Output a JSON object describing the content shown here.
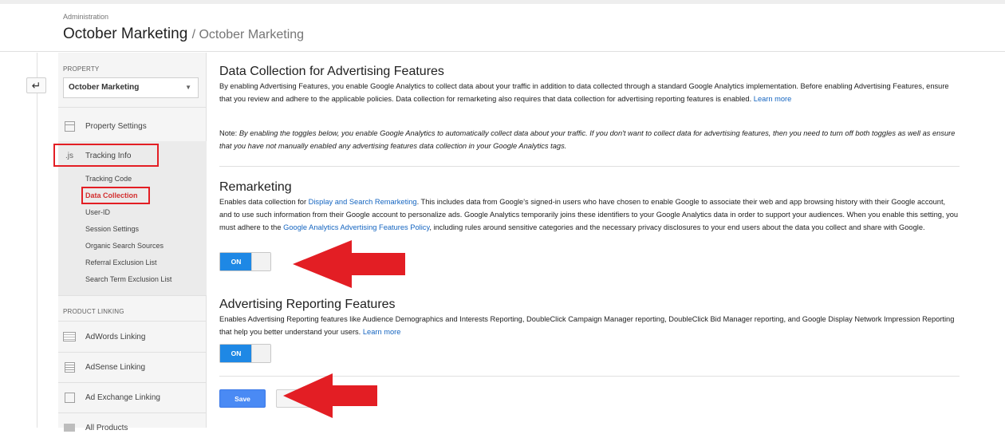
{
  "header": {
    "breadcrumb_small": "Administration",
    "title": "October Marketing",
    "subtitle": "/ October Marketing"
  },
  "sidebar": {
    "property_label": "PROPERTY",
    "property_select": "October Marketing",
    "property_settings": "Property Settings",
    "tracking_info_icon": ".js",
    "tracking_info": "Tracking Info",
    "sub_items": [
      "Tracking Code",
      "Data Collection",
      "User-ID",
      "Session Settings",
      "Organic Search Sources",
      "Referral Exclusion List",
      "Search Term Exclusion List"
    ],
    "product_linking_label": "PRODUCT LINKING",
    "adwords": "AdWords Linking",
    "adsense": "AdSense Linking",
    "adexchange": "Ad Exchange Linking",
    "all_products": "All Products"
  },
  "main": {
    "title": "Data Collection for Advertising Features",
    "intro": "By enabling Advertising Features, you enable Google Analytics to collect data about your traffic in addition to data collected through a standard Google Analytics implementation. Before enabling Advertising Features, ensure that you review and adhere to the applicable policies. Data collection for remarketing also requires that data collection for advertising reporting features is enabled.",
    "intro_link": "Learn more",
    "note_label": "Note:",
    "note_text": "By enabling the toggles below, you enable Google Analytics to automatically collect data about your traffic. If you don't want to collect data for advertising features, then you need to turn off both toggles as well as ensure that you have not manually enabled any advertising features data collection in your Google Analytics tags.",
    "remarketing": {
      "title": "Remarketing",
      "text_a": "Enables data collection for",
      "link_a": "Display and Search Remarketing",
      "text_b": ". This includes data from Google's signed-in users who have chosen to enable Google to associate their web and app browsing history with their Google account, and to use such information from their Google account to personalize ads. Google Analytics temporarily joins these identifiers to your Google Analytics data in order to support your audiences. When you enable this setting, you must adhere to the",
      "link_b": "Google Analytics Advertising Features Policy",
      "text_c": ", including rules around sensitive categories and the necessary privacy disclosures to your end users about the data you collect and share with Google.",
      "toggle": "ON"
    },
    "reporting": {
      "title": "Advertising Reporting Features",
      "text": "Enables Advertising Reporting features like Audience Demographics and Interests Reporting, DoubleClick Campaign Manager reporting, DoubleClick Bid Manager reporting, and Google Display Network Impression Reporting that help you better understand your users.",
      "link": "Learn more",
      "toggle": "ON"
    },
    "save": "Save",
    "cancel": ""
  },
  "colors": {
    "accent": "#1e88e5",
    "highlight": "#e31e24",
    "active_nav": "#d32f2f",
    "link": "#1565c0"
  }
}
